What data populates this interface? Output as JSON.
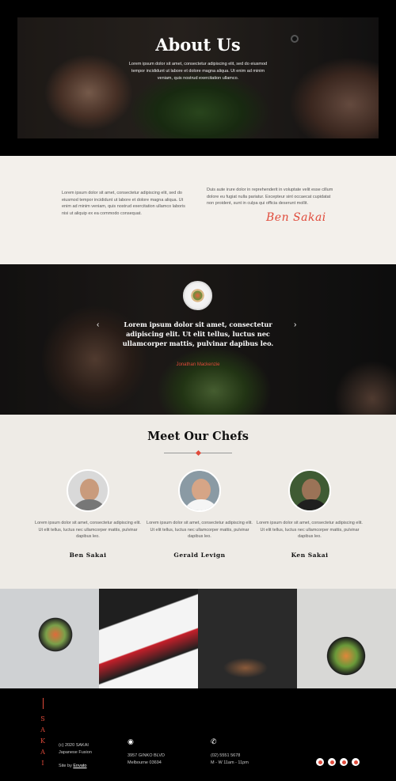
{
  "hero": {
    "title": "About Us",
    "text": "Lorem ipsum dolor sit amet, consectetur adipiscing elit, sed do eiusmod tempor incididunt ut labore et dolore magna aliqua. Ut enim ad minim veniam, quis nostrud exercitation ullamco."
  },
  "intro": {
    "col1": "Lorem ipsum dolor sit amet, consectetur adipiscing elit, sed do eiusmod tempor incididunt ut labore et dolore magna aliqua. Ut enim ad minim veniam, quis nostrud exercitation ullamco laboris nisi ut aliquip ex ea commodo consequat.",
    "col2": "Duis aute irure dolor in reprehenderit in voluptate velit esse cillum dolore eu fugiat nulla pariatur. Excepteur sint occaecat cupidatat non proident, sunt in culpa qui officia deserunt mollit.",
    "signature": "Ben Sakai"
  },
  "testimonial": {
    "quote": "Lorem ipsum dolor sit amet, consectetur adipiscing elit. Ut elit tellus, luctus nec ullamcorper mattis, pulvinar dapibus leo.",
    "author": "Jonathan Mackenzie",
    "prev": "‹",
    "next": "›"
  },
  "chefs": {
    "title": "Meet Our Chefs",
    "items": [
      {
        "name": "Ben Sakai",
        "text": "Lorem ipsum dolor sit amet, consectetur adipiscing elit. Ut elit tellus, luctus nec ullamcorper mattis, pulvinar dapibus leo."
      },
      {
        "name": "Gerald Levign",
        "text": "Lorem ipsum dolor sit amet, consectetur adipiscing elit. Ut elit tellus, luctus nec ullamcorper mattis, pulvinar dapibus leo."
      },
      {
        "name": "Ken Sakai",
        "text": "Lorem ipsum dolor sit amet, consectetur adipiscing elit. Ut elit tellus, luctus nec ullamcorper mattis, pulvinar dapibus leo."
      }
    ]
  },
  "footer": {
    "brand_letters": [
      "S",
      "A",
      "K",
      "A",
      "I"
    ],
    "copyright": "(c) 2020 SAKAI",
    "tagline": "Japanese Fusion",
    "site_by_label": "Site by",
    "site_by_link": "Envato",
    "address_line1": "3957 GINKO BLVD",
    "address_line2": "Melbourne 03694",
    "phone": "(02) 5551 5678",
    "hours": "M - W 11am - 11pm"
  },
  "colors": {
    "accent": "#e04a3a",
    "cream": "#f3f0eb",
    "dark": "#000000"
  }
}
